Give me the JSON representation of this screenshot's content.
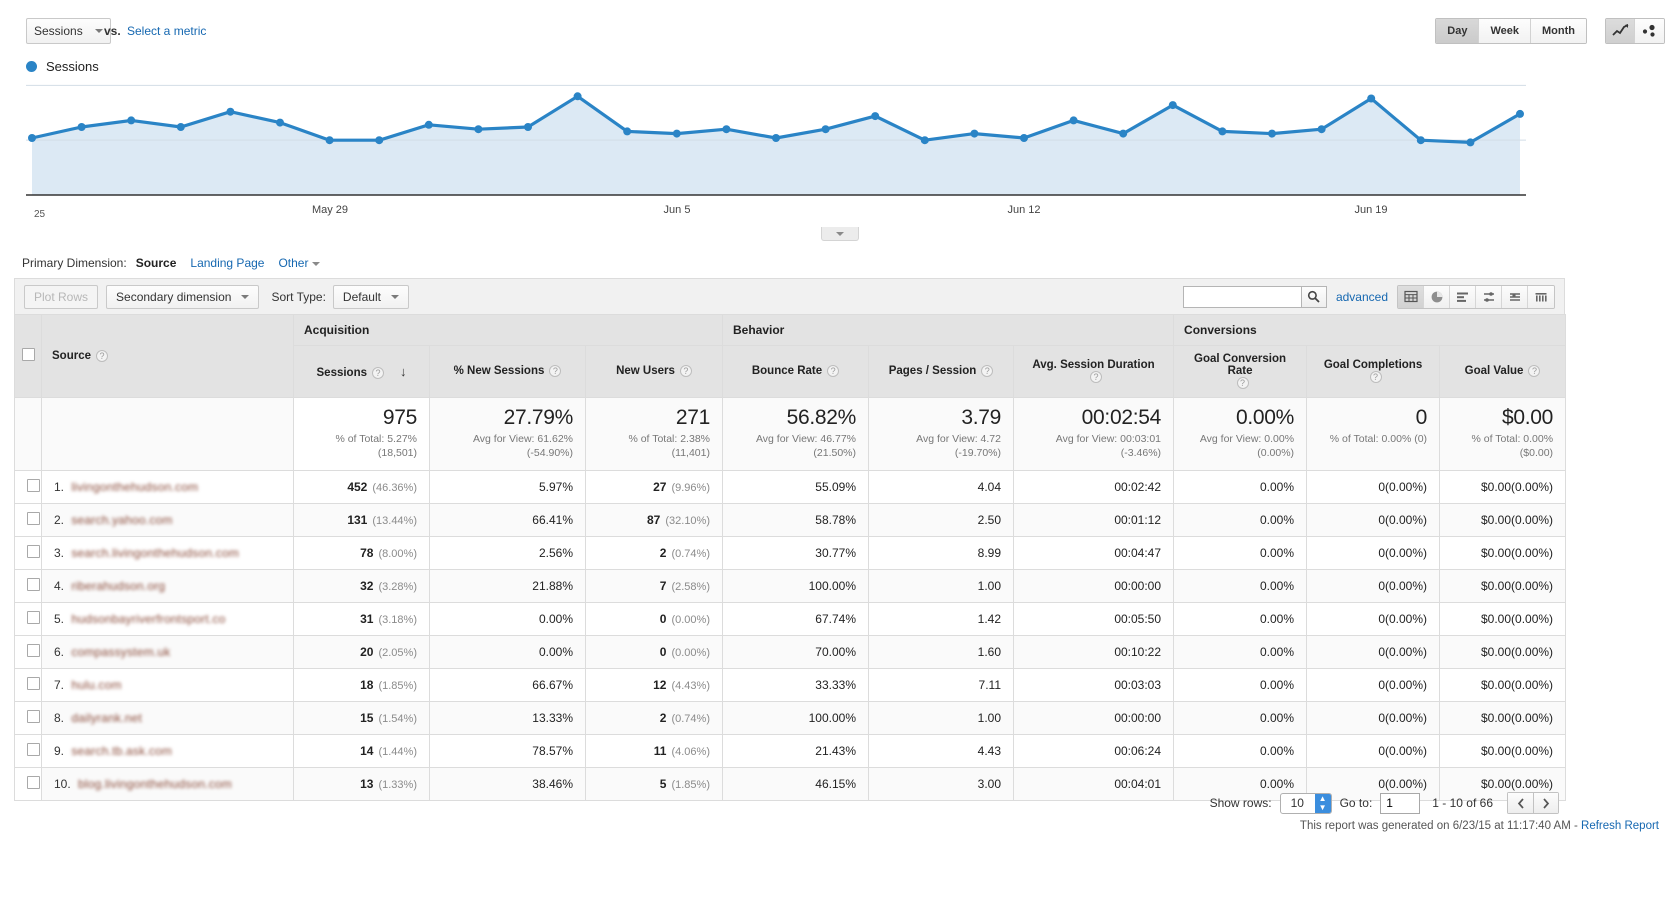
{
  "toolbar_top": {
    "metric_select": "Sessions",
    "vs_label": "vs.",
    "select_metric_link": "Select a metric",
    "legend_label": "Sessions",
    "granularity": [
      "Day",
      "Week",
      "Month"
    ],
    "granularity_active": "Day",
    "chart_types": [
      "line-chart-icon",
      "motion-chart-icon"
    ]
  },
  "chart_data": {
    "type": "line",
    "title": "Sessions",
    "xlabel": "",
    "ylabel": "Sessions",
    "ylim": [
      0,
      57
    ],
    "yticks": [
      25,
      50
    ],
    "grid": true,
    "legend": [
      "Sessions"
    ],
    "legend_position": "top-left",
    "xtick_labels": [
      "May 29",
      "Jun 5",
      "Jun 12",
      "Jun 19"
    ],
    "xtick_indices": [
      6,
      13,
      20,
      27
    ],
    "series": [
      {
        "name": "Sessions",
        "color": "#2a84c6",
        "values": [
          26,
          31,
          34,
          31,
          38,
          33,
          25,
          25,
          32,
          30,
          31,
          45,
          29,
          28,
          30,
          26,
          30,
          36,
          25,
          28,
          26,
          34,
          28,
          41,
          29,
          28,
          30,
          44,
          25,
          24,
          37
        ]
      }
    ]
  },
  "primary_dimension": {
    "label": "Primary Dimension:",
    "active": "Source",
    "links": [
      "Landing Page"
    ],
    "other": "Other"
  },
  "table_toolbar": {
    "plot_rows": "Plot Rows",
    "secondary_dimension": "Secondary dimension",
    "sort_type_label": "Sort Type:",
    "sort_type_value": "Default",
    "search_value": "",
    "search_placeholder": "",
    "advanced": "advanced",
    "view_modes": [
      "table-view-icon",
      "pie-chart-view-icon",
      "bar-chart-view-icon",
      "comparison-view-icon",
      "pivot-view-icon",
      "performance-view-icon"
    ],
    "view_mode_active": "table-view-icon"
  },
  "table": {
    "group_headers": [
      {
        "label": "Acquisition",
        "span": 3
      },
      {
        "label": "Behavior",
        "span": 3
      },
      {
        "label": "Conversions",
        "span": 3
      }
    ],
    "dimension_header": "Source",
    "columns": [
      "Sessions",
      "% New Sessions",
      "New Users",
      "Bounce Rate",
      "Pages / Session",
      "Avg. Session Duration",
      "Goal Conversion Rate",
      "Goal Completions",
      "Goal Value"
    ],
    "sorted_column": "Sessions",
    "sort_direction": "desc",
    "summary": [
      {
        "value": "975",
        "sub1": "% of Total: 5.27%",
        "sub2": "(18,501)"
      },
      {
        "value": "27.79%",
        "sub1": "Avg for View: 61.62%",
        "sub2": "(-54.90%)"
      },
      {
        "value": "271",
        "sub1": "% of Total: 2.38%",
        "sub2": "(11,401)"
      },
      {
        "value": "56.82%",
        "sub1": "Avg for View: 46.77%",
        "sub2": "(21.50%)"
      },
      {
        "value": "3.79",
        "sub1": "Avg for View: 4.72",
        "sub2": "(-19.70%)"
      },
      {
        "value": "00:02:54",
        "sub1": "Avg for View: 00:03:01",
        "sub2": "(-3.46%)"
      },
      {
        "value": "0.00%",
        "sub1": "Avg for View: 0.00%",
        "sub2": "(0.00%)"
      },
      {
        "value": "0",
        "sub1": "% of Total: 0.00% (0)",
        "sub2": ""
      },
      {
        "value": "$0.00",
        "sub1": "% of Total: 0.00%",
        "sub2": "($0.00)"
      }
    ],
    "rows": [
      {
        "index": "1.",
        "source": "livingonthehudson.com",
        "sessions": "452",
        "sessions_pct": "(46.36%)",
        "new_sessions": "5.97%",
        "new_users": "27",
        "new_users_pct": "(9.96%)",
        "bounce_rate": "55.09%",
        "pages_session": "4.04",
        "avg_duration": "00:02:42",
        "goal_conv_rate": "0.00%",
        "goal_completions": "0",
        "goal_completions_pct": "(0.00%)",
        "goal_value": "$0.00",
        "goal_value_pct": "(0.00%)"
      },
      {
        "index": "2.",
        "source": "search.yahoo.com",
        "sessions": "131",
        "sessions_pct": "(13.44%)",
        "new_sessions": "66.41%",
        "new_users": "87",
        "new_users_pct": "(32.10%)",
        "bounce_rate": "58.78%",
        "pages_session": "2.50",
        "avg_duration": "00:01:12",
        "goal_conv_rate": "0.00%",
        "goal_completions": "0",
        "goal_completions_pct": "(0.00%)",
        "goal_value": "$0.00",
        "goal_value_pct": "(0.00%)"
      },
      {
        "index": "3.",
        "source": "search.livingonthehudson.com",
        "sessions": "78",
        "sessions_pct": "(8.00%)",
        "new_sessions": "2.56%",
        "new_users": "2",
        "new_users_pct": "(0.74%)",
        "bounce_rate": "30.77%",
        "pages_session": "8.99",
        "avg_duration": "00:04:47",
        "goal_conv_rate": "0.00%",
        "goal_completions": "0",
        "goal_completions_pct": "(0.00%)",
        "goal_value": "$0.00",
        "goal_value_pct": "(0.00%)"
      },
      {
        "index": "4.",
        "source": "riberahudson.org",
        "sessions": "32",
        "sessions_pct": "(3.28%)",
        "new_sessions": "21.88%",
        "new_users": "7",
        "new_users_pct": "(2.58%)",
        "bounce_rate": "100.00%",
        "pages_session": "1.00",
        "avg_duration": "00:00:00",
        "goal_conv_rate": "0.00%",
        "goal_completions": "0",
        "goal_completions_pct": "(0.00%)",
        "goal_value": "$0.00",
        "goal_value_pct": "(0.00%)"
      },
      {
        "index": "5.",
        "source": "hudsonbayriverfrontsport.co",
        "sessions": "31",
        "sessions_pct": "(3.18%)",
        "new_sessions": "0.00%",
        "new_users": "0",
        "new_users_pct": "(0.00%)",
        "bounce_rate": "67.74%",
        "pages_session": "1.42",
        "avg_duration": "00:05:50",
        "goal_conv_rate": "0.00%",
        "goal_completions": "0",
        "goal_completions_pct": "(0.00%)",
        "goal_value": "$0.00",
        "goal_value_pct": "(0.00%)"
      },
      {
        "index": "6.",
        "source": "compassystem.uk",
        "sessions": "20",
        "sessions_pct": "(2.05%)",
        "new_sessions": "0.00%",
        "new_users": "0",
        "new_users_pct": "(0.00%)",
        "bounce_rate": "70.00%",
        "pages_session": "1.60",
        "avg_duration": "00:10:22",
        "goal_conv_rate": "0.00%",
        "goal_completions": "0",
        "goal_completions_pct": "(0.00%)",
        "goal_value": "$0.00",
        "goal_value_pct": "(0.00%)"
      },
      {
        "index": "7.",
        "source": "hulu.com",
        "sessions": "18",
        "sessions_pct": "(1.85%)",
        "new_sessions": "66.67%",
        "new_users": "12",
        "new_users_pct": "(4.43%)",
        "bounce_rate": "33.33%",
        "pages_session": "7.11",
        "avg_duration": "00:03:03",
        "goal_conv_rate": "0.00%",
        "goal_completions": "0",
        "goal_completions_pct": "(0.00%)",
        "goal_value": "$0.00",
        "goal_value_pct": "(0.00%)"
      },
      {
        "index": "8.",
        "source": "dailyrank.net",
        "sessions": "15",
        "sessions_pct": "(1.54%)",
        "new_sessions": "13.33%",
        "new_users": "2",
        "new_users_pct": "(0.74%)",
        "bounce_rate": "100.00%",
        "pages_session": "1.00",
        "avg_duration": "00:00:00",
        "goal_conv_rate": "0.00%",
        "goal_completions": "0",
        "goal_completions_pct": "(0.00%)",
        "goal_value": "$0.00",
        "goal_value_pct": "(0.00%)"
      },
      {
        "index": "9.",
        "source": "search.tb.ask.com",
        "sessions": "14",
        "sessions_pct": "(1.44%)",
        "new_sessions": "78.57%",
        "new_users": "11",
        "new_users_pct": "(4.06%)",
        "bounce_rate": "21.43%",
        "pages_session": "4.43",
        "avg_duration": "00:06:24",
        "goal_conv_rate": "0.00%",
        "goal_completions": "0",
        "goal_completions_pct": "(0.00%)",
        "goal_value": "$0.00",
        "goal_value_pct": "(0.00%)"
      },
      {
        "index": "10.",
        "source": "blog.livingonthehudson.com",
        "sessions": "13",
        "sessions_pct": "(1.33%)",
        "new_sessions": "38.46%",
        "new_users": "5",
        "new_users_pct": "(1.85%)",
        "bounce_rate": "46.15%",
        "pages_session": "3.00",
        "avg_duration": "00:04:01",
        "goal_conv_rate": "0.00%",
        "goal_completions": "0",
        "goal_completions_pct": "(0.00%)",
        "goal_value": "$0.00",
        "goal_value_pct": "(0.00%)"
      }
    ]
  },
  "footer": {
    "show_rows_label": "Show rows:",
    "show_rows_value": "10",
    "go_to_label": "Go to:",
    "go_to_value": "1",
    "range_label": "1 - 10 of 66",
    "prev_icon": "chevron-left-icon",
    "next_icon": "chevron-right-icon",
    "generated_text": "This report was generated on 6/23/15 at 11:17:40 AM -",
    "refresh_link": "Refresh Report"
  }
}
